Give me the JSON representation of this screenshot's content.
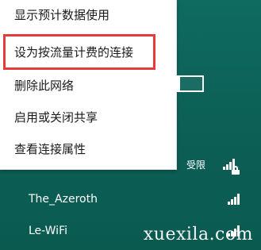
{
  "menu": {
    "items": [
      {
        "label": "显示预计数据使用"
      },
      {
        "label": "设为按流量计费的连接"
      },
      {
        "label": "删除此网络"
      },
      {
        "label": "启用或关闭共享"
      },
      {
        "label": "查看连接属性"
      }
    ]
  },
  "networks": {
    "limited_text": "受限",
    "items": [
      {
        "name": "The_Azeroth",
        "signal_level": 4
      },
      {
        "name": "Le-WiFi",
        "signal_level": 4
      }
    ]
  },
  "toggle": {
    "state": "off"
  },
  "watermark": {
    "text": "xuexila.com"
  },
  "colors": {
    "background": "#0e5e54",
    "menu_bg": "#ffffff",
    "highlight": "#e43b3b",
    "text_light": "#ffffff",
    "text_dark": "#1a1a1a"
  }
}
